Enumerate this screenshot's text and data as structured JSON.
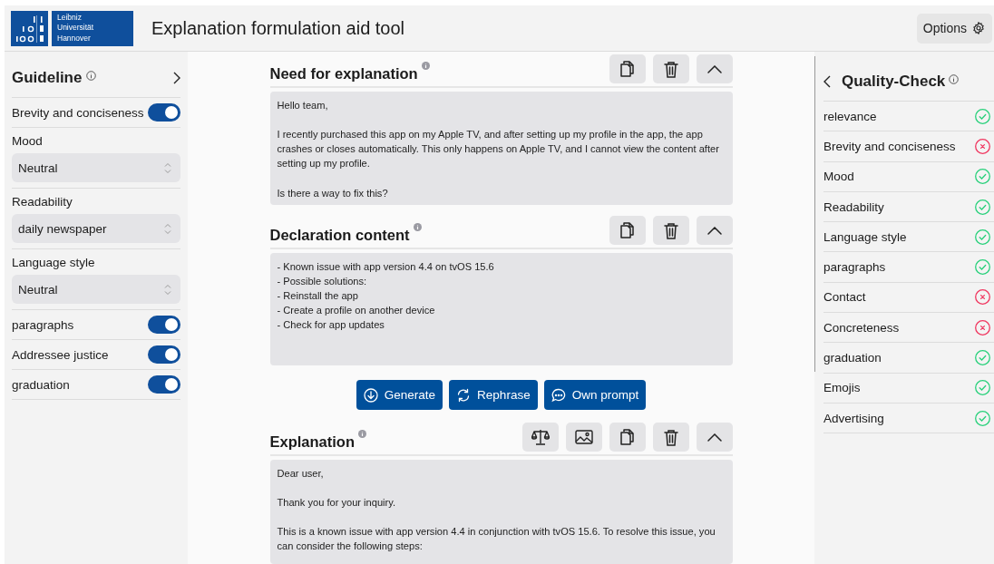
{
  "header": {
    "logo_text": [
      "Leibniz",
      "Universität",
      "Hannover"
    ],
    "title": "Explanation formulation aid tool",
    "options_button": "Options"
  },
  "guideline": {
    "title": "Guideline",
    "items": [
      {
        "kind": "toggle",
        "label": "Brevity and conciseness",
        "on": true
      },
      {
        "kind": "select",
        "label": "Mood",
        "value": "Neutral"
      },
      {
        "kind": "select",
        "label": "Readability",
        "value": "daily newspaper"
      },
      {
        "kind": "select",
        "label": "Language style",
        "value": "Neutral"
      },
      {
        "kind": "toggle",
        "label": "paragraphs",
        "on": true
      },
      {
        "kind": "toggle",
        "label": "Addressee justice",
        "on": true
      },
      {
        "kind": "toggle",
        "label": "graduation",
        "on": true
      }
    ]
  },
  "sections": [
    {
      "title": "Need for explanation",
      "buttons": [
        {
          "kind": "copy"
        },
        {
          "kind": "delete"
        },
        {
          "kind": "collapse"
        }
      ],
      "text": "Hello team,\n\nI recently purchased this app on my Apple TV, and after setting up my profile in the app, the app crashes or closes automatically. This only happens on Apple TV, and I cannot view the content after setting up my profile.\n\nIs there a way to fix this?"
    },
    {
      "title": "Declaration content",
      "buttons": [
        {
          "kind": "copy"
        },
        {
          "kind": "delete"
        },
        {
          "kind": "collapse"
        }
      ],
      "text": "- Known issue with app version 4.4 on tvOS 15.6\n- Possible solutions:\n- Reinstall the app\n- Create a profile on another device\n- Check for app updates"
    },
    {
      "title": "Explanation",
      "buttons": [
        {
          "kind": "balance"
        },
        {
          "kind": "image"
        },
        {
          "kind": "copy"
        },
        {
          "kind": "delete"
        },
        {
          "kind": "collapse"
        }
      ],
      "text": "Dear user,\n\nThank you for your inquiry.\n\nThis is a known issue with app version 4.4 in conjunction with tvOS 15.6. To resolve this issue, you can consider the following steps:"
    }
  ],
  "action_buttons": [
    {
      "kind": "generate",
      "label": "Generate"
    },
    {
      "kind": "rephrase",
      "label": "Rephrase"
    },
    {
      "kind": "prompt",
      "label": "Own prompt"
    }
  ],
  "quality_check": {
    "title": "Quality-Check",
    "items": [
      {
        "label": "relevance",
        "passed": true
      },
      {
        "label": "Brevity and conciseness",
        "passed": false
      },
      {
        "label": "Mood",
        "passed": true
      },
      {
        "label": "Readability",
        "passed": true
      },
      {
        "label": "Language style",
        "passed": true
      },
      {
        "label": "paragraphs",
        "passed": true
      },
      {
        "label": "Contact",
        "passed": false
      },
      {
        "label": "Concreteness",
        "passed": false
      },
      {
        "label": "graduation",
        "passed": true
      },
      {
        "label": "Emojis",
        "passed": true
      },
      {
        "label": "Advertising",
        "passed": true
      }
    ]
  }
}
